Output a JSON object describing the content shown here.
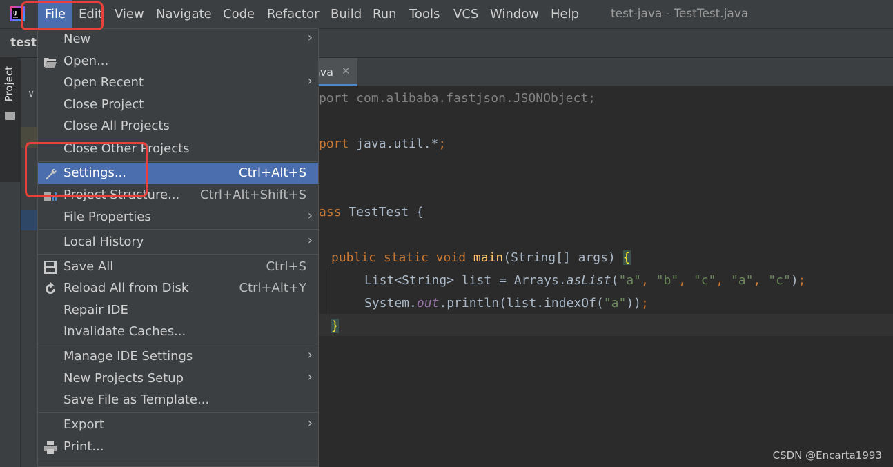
{
  "window": {
    "title": "test-java - TestTest.java"
  },
  "menubar": {
    "items": [
      {
        "label": "File"
      },
      {
        "label": "Edit"
      },
      {
        "label": "View"
      },
      {
        "label": "Navigate"
      },
      {
        "label": "Code"
      },
      {
        "label": "Refactor"
      },
      {
        "label": "Build"
      },
      {
        "label": "Run"
      },
      {
        "label": "Tools"
      },
      {
        "label": "VCS"
      },
      {
        "label": "Window"
      },
      {
        "label": "Help"
      }
    ]
  },
  "navbar": {
    "project": "test-"
  },
  "tool_strip": {
    "project_label": "Project"
  },
  "editor": {
    "tab_label": "ava",
    "lines": [
      "port com.alibaba.fastjson.JSONObject;",
      "port java.util.*;",
      "ass TestTest {",
      "public static void main(String[] args) {",
      "List<String> list = Arrays.asList(\"a\", \"b\", \"c\", \"a\", \"c\");",
      "System.out.println(list.indexOf(\"a\"));",
      "}"
    ]
  },
  "file_menu": {
    "items": [
      {
        "label": "New",
        "submenu": true
      },
      {
        "label": "Open...",
        "icon": "folder-open-icon"
      },
      {
        "label": "Open Recent",
        "submenu": true
      },
      {
        "label": "Close Project"
      },
      {
        "label": "Close All Projects"
      },
      {
        "label": "Close Other Projects"
      },
      {
        "label": "Settings...",
        "shortcut": "Ctrl+Alt+S",
        "icon": "wrench-icon",
        "selected": true
      },
      {
        "label": "Project Structure...",
        "shortcut": "Ctrl+Alt+Shift+S",
        "icon": "project-structure-icon"
      },
      {
        "label": "File Properties",
        "submenu": true
      },
      {
        "label": "Local History",
        "submenu": true
      },
      {
        "label": "Save All",
        "shortcut": "Ctrl+S",
        "icon": "save-icon"
      },
      {
        "label": "Reload All from Disk",
        "shortcut": "Ctrl+Alt+Y",
        "icon": "reload-icon"
      },
      {
        "label": "Repair IDE"
      },
      {
        "label": "Invalidate Caches..."
      },
      {
        "label": "Manage IDE Settings",
        "submenu": true
      },
      {
        "label": "New Projects Setup",
        "submenu": true
      },
      {
        "label": "Save File as Template..."
      },
      {
        "label": "Export",
        "submenu": true
      },
      {
        "label": "Print...",
        "icon": "printer-icon"
      }
    ]
  },
  "colors": {
    "menu_selected": "#4b6eaf",
    "annotation": "#e8403a",
    "keyword": "#cc7832",
    "string": "#6a8759"
  },
  "watermark": "CSDN @Encarta1993"
}
